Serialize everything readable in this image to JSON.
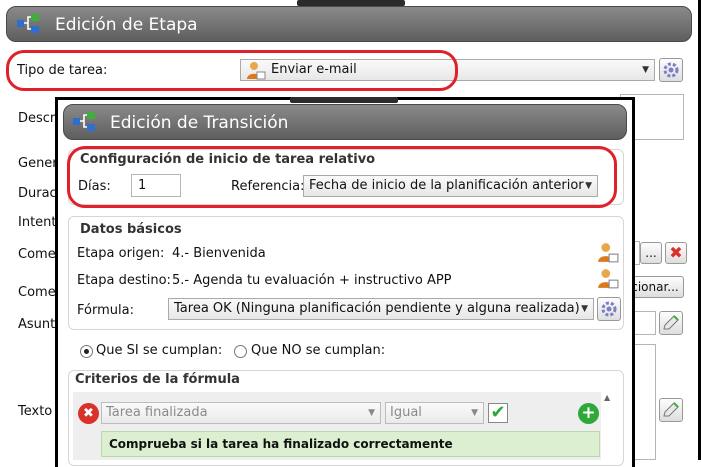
{
  "outer": {
    "title": "Edición de Etapa",
    "tipo_tarea_label": "Tipo de tarea:",
    "tipo_tarea_value": "Enviar e-mail",
    "side_labels": [
      "Descri",
      "Gener",
      "Durac",
      "Intent",
      "Come",
      "Come",
      "Asunt",
      "Texto"
    ],
    "side_button_ellipsis": "...",
    "side_button_partial": "cionar..."
  },
  "inner": {
    "title": "Edición de Transición",
    "config": {
      "group_title": "Configuración de inicio de tarea relativo",
      "dias_label": "Días:",
      "dias_value": "1",
      "referencia_label": "Referencia:",
      "referencia_value": "Fecha de inicio de la planificación anterior"
    },
    "basic": {
      "group_title": "Datos básicos",
      "origen_label": "Etapa origen:",
      "origen_value": "4.- Bienvenida",
      "destino_label": "Etapa destino:",
      "destino_value": "5.- Agenda tu evaluación + instructivo APP",
      "formula_label": "Fórmula:",
      "formula_value": "Tarea OK (Ninguna planificación pendiente y alguna realizada)"
    },
    "radios": {
      "si_label": "Que SI se cumplan:",
      "no_label": "Que NO se cumplan:",
      "selected": "si"
    },
    "criteria": {
      "group_title": "Criterios de la fórmula",
      "field_value": "Tarea finalizada",
      "operator_value": "Igual",
      "checked": true,
      "description": "Comprueba si la tarea ha finalizado correctamente"
    }
  },
  "colors": {
    "title_bar": "#6f6f6f",
    "highlight_ring": "#e0202a",
    "description_bg": "#dcefd0",
    "delete_red": "#d9322a",
    "add_green": "#2fa83a"
  }
}
